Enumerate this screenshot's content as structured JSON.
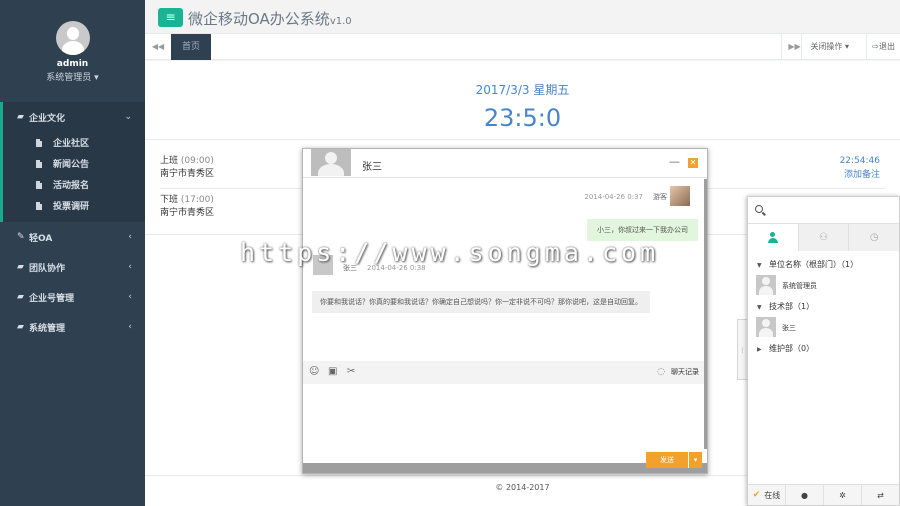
{
  "app": {
    "title": "微企移动OA办公系统",
    "version": "v1.0"
  },
  "profile": {
    "name": "admin",
    "role": "系统管理员 ▾"
  },
  "sidebar": {
    "items": [
      {
        "label": "企业文化",
        "icon": "folder-open-icon",
        "expanded": true,
        "children": [
          {
            "label": "企业社区"
          },
          {
            "label": "新闻公告"
          },
          {
            "label": "活动报名"
          },
          {
            "label": "投票调研"
          }
        ]
      },
      {
        "label": "轻OA",
        "icon": "edit-icon"
      },
      {
        "label": "团队协作",
        "icon": "folder-open-icon"
      },
      {
        "label": "企业号管理",
        "icon": "folder-open-icon"
      },
      {
        "label": "系统管理",
        "icon": "folder-open-icon"
      }
    ]
  },
  "tabs": {
    "home": "首页",
    "ops": "关闭操作 ▾",
    "exit": "⇨退出"
  },
  "dashboard": {
    "date": "2017/3/3   星期五",
    "time": "23:5:0",
    "checkin": {
      "title": "上班",
      "time": "(09:00)",
      "location": "南宁市青秀区",
      "clock": "22:54:46",
      "action": "添加备注"
    },
    "checkout": {
      "title": "下班",
      "time": "(17:00)",
      "location": "南宁市青秀区"
    },
    "footer": "© 2014-2017"
  },
  "watermark": "https://www.songma.com",
  "chat": {
    "contact": "张三",
    "messages": [
      {
        "side": "right",
        "time": "2014-04-26 0:37",
        "name": "游客",
        "text": "小三，你叔过来一下我办公司"
      },
      {
        "side": "left",
        "time": "2014-04-26 0:38",
        "name": "张三",
        "text": "你要和我说话？你真的要和我说话？你确定自己想说吗？你一定非说不可吗？那你说吧，这是自动回复。"
      }
    ],
    "history_label": "聊天记录",
    "send_label": "发送"
  },
  "contacts": {
    "root": "单位名称（根部门）（1）",
    "root_members": [
      "系统管理员"
    ],
    "groups": [
      {
        "label": "技术部（1）",
        "expanded": true,
        "members": [
          "张三"
        ]
      },
      {
        "label": "维护部（0）",
        "expanded": false,
        "members": []
      }
    ],
    "footer": {
      "online": "在线"
    }
  },
  "colors": {
    "sidebar": "#2f4050",
    "accent": "#1ab394",
    "link": "#4a86c7",
    "send": "#f2a12c"
  }
}
